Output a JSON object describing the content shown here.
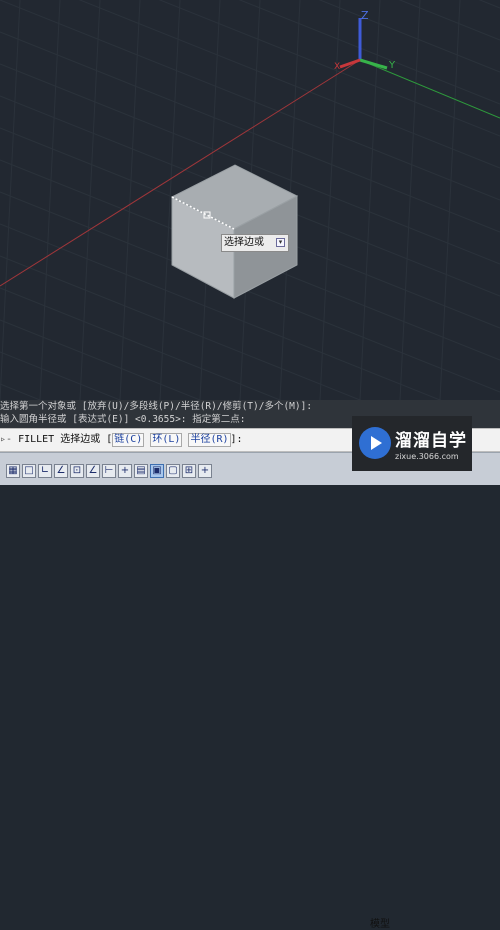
{
  "viewport": {
    "ucs_labels": {
      "z": "Z",
      "y": "Y",
      "x": "X"
    },
    "colors": {
      "background": "#222831",
      "grid": "#2b323b",
      "x_axis": "#c8373b",
      "y_axis": "#37b34a",
      "z_axis": "#3f5bd8"
    },
    "tooltip": {
      "text": "选择边或",
      "arrow_icon": "expand-arrow-icon"
    }
  },
  "command_history": [
    "选择第一个对象或 [放弃(U)/多段线(P)/半径(R)/修剪(T)/多个(M)]:",
    "输入圆角半径或 [表达式(E)] <0.3655>:  指定第二点:"
  ],
  "command_line": {
    "prefix": "▹-",
    "command": "FILLET 选择边或 [",
    "options": [
      "链(C)",
      "环(L)",
      "半径(R)"
    ],
    "suffix": "]:"
  },
  "status_bar": {
    "model_tab": "模型",
    "icons": [
      "grid-icon",
      "snap-icon",
      "ortho-icon",
      "polar-icon",
      "osnap-icon",
      "otrack-icon",
      "ducs-icon",
      "dyn-icon",
      "lineweight-icon",
      "transparency-icon",
      "selection-cycling-icon",
      "annotation-monitor-icon",
      "plus-icon"
    ],
    "icon_glyphs": [
      "▦",
      "□",
      "∟",
      "∠",
      "⊡",
      "∠",
      "⊢",
      "+",
      "▤",
      "▣",
      "▢",
      "⊞",
      "+"
    ]
  },
  "watermark": {
    "title": "溜溜自学",
    "url": "zixue.3066.com"
  }
}
